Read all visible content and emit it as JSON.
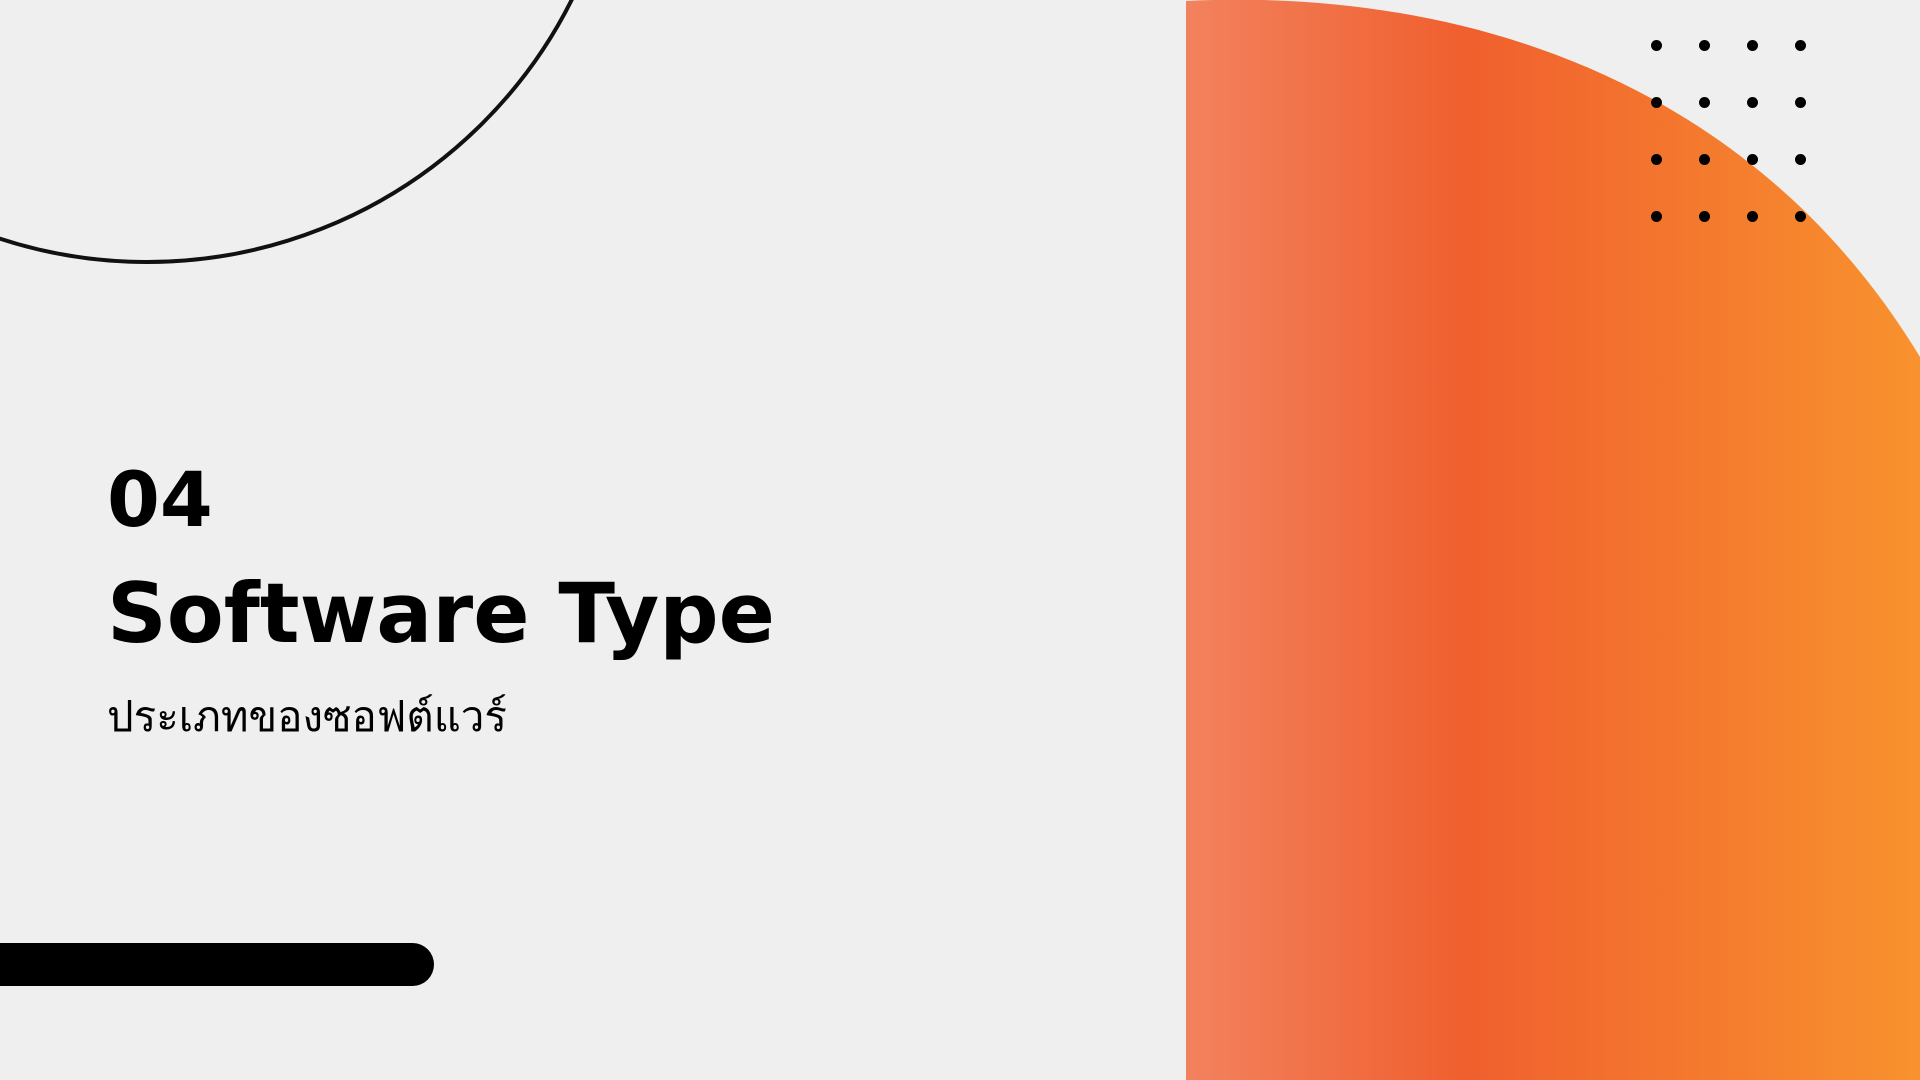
{
  "slide": {
    "number": "04",
    "title": "Software Type",
    "subtitle": "ประเภทของซอฟต์แวร์"
  },
  "colors": {
    "background": "#efefef",
    "accent_orange_light": "#f2825e",
    "accent_orange_mid": "#f05f2e",
    "accent_orange_end": "#f8922e",
    "text": "#000000"
  },
  "decorations": {
    "dot_grid": {
      "rows": 4,
      "columns": 4
    },
    "icons": [
      "circle-outline-arc",
      "orange-quarter-disc",
      "dot-grid",
      "rounded-bar"
    ]
  }
}
